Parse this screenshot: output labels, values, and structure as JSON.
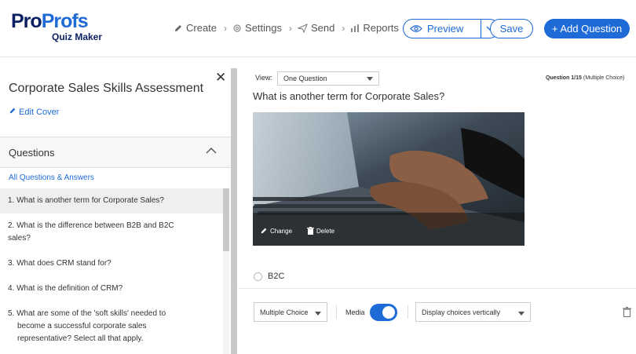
{
  "app": {
    "logo_pro": "Pro",
    "logo_profs": "Profs",
    "logo_sub": "Quiz Maker"
  },
  "nav": {
    "create": "Create",
    "settings": "Settings",
    "send": "Send",
    "reports": "Reports"
  },
  "toolbar": {
    "preview_label": "Preview",
    "save_label": "Save",
    "add_question_label": "+ Add Question"
  },
  "sidebar": {
    "quiz_title": "Corporate Sales Skills Assessment",
    "edit_cover_label": "Edit Cover",
    "questions_header": "Questions",
    "all_qa_link": "All Questions & Answers",
    "items": [
      {
        "label": "1. What is another term for Corporate Sales?"
      },
      {
        "label": "2. What is the difference between B2B and B2C sales?"
      },
      {
        "label": "3. What does CRM stand for?"
      },
      {
        "label": "4. What is the definition of CRM?"
      },
      {
        "label": "5. What are some of the 'soft skills' needed to become a successful corporate sales representative? Select all that apply."
      }
    ]
  },
  "main": {
    "view_label": "View:",
    "view_selected": "One Question",
    "question_count": "Question 1/15",
    "question_type_note": "(Multiple Choice)",
    "question_text": "What is another term for Corporate Sales?",
    "media_change_label": "Change",
    "media_delete_label": "Delete",
    "choices": [
      {
        "label": "B2C",
        "selected": false
      }
    ],
    "question_type_selected": "Multiple Choice",
    "media_toggle_label": "Media",
    "media_toggle_on": true,
    "display_selected": "Display choices vertically"
  },
  "colors": {
    "accent": "#1e6ad6",
    "logo_dark": "#0b1f63"
  }
}
